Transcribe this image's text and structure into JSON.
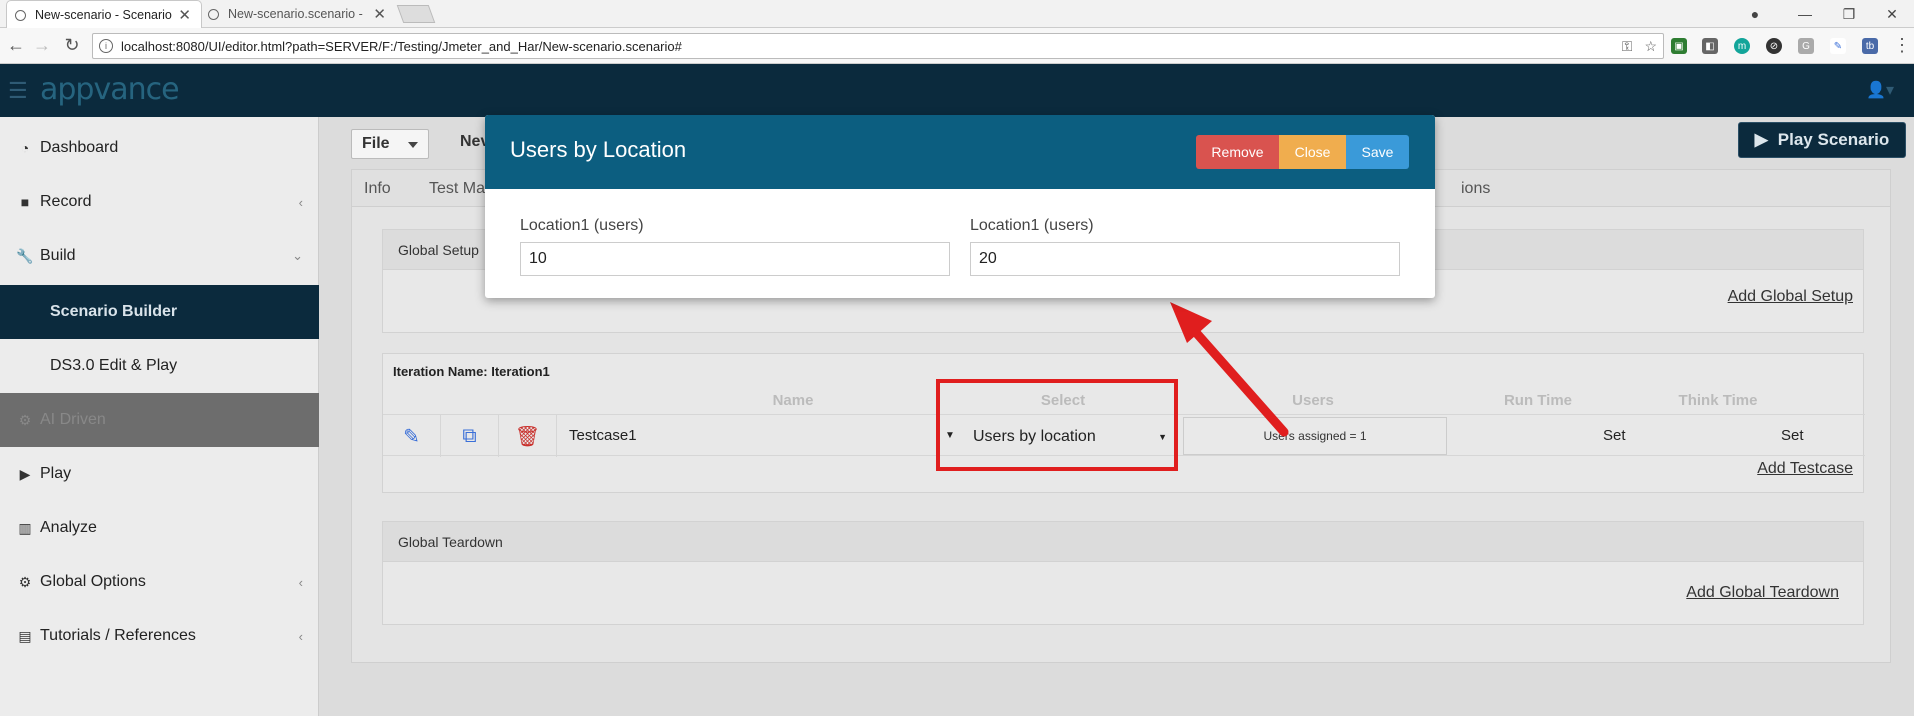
{
  "browser": {
    "tabs": [
      {
        "title": "New-scenario - Scenario"
      },
      {
        "title": "New-scenario.scenario -"
      }
    ],
    "url": "localhost:8080/UI/editor.html?path=SERVER/F:/Testing/Jmeter_and_Har/New-scenario.scenario#"
  },
  "app": {
    "logo": "appvance"
  },
  "sidebar": {
    "items": [
      {
        "label": "Dashboard"
      },
      {
        "label": "Record"
      },
      {
        "label": "Build"
      },
      {
        "label": "Scenario Builder"
      },
      {
        "label": "DS3.0 Edit & Play"
      },
      {
        "label": "AI Driven"
      },
      {
        "label": "Play"
      },
      {
        "label": "Analyze"
      },
      {
        "label": "Global Options"
      },
      {
        "label": "Tutorials / References"
      }
    ]
  },
  "toolbar": {
    "file_label": "File",
    "name_partial": "Nev",
    "play_label": "Play Scenario"
  },
  "tabs": {
    "info": "Info",
    "test_partial": "Test Ma",
    "options_partial": "ions"
  },
  "global_setup": {
    "title": "Global Setup",
    "add_link": "Add Global Setup"
  },
  "iteration": {
    "header": "Iteration Name: Iteration1",
    "columns": [
      "Name",
      "Select",
      "Users",
      "Run Time",
      "Think Time"
    ],
    "row": {
      "name": "Testcase1",
      "select": "Users by location",
      "users": "Users assigned = 1",
      "run_time": "Set",
      "think_time": "Set"
    },
    "add_link": "Add Testcase"
  },
  "global_teardown": {
    "title": "Global Teardown",
    "add_link": "Add Global Teardown"
  },
  "modal": {
    "title": "Users by Location",
    "remove_label": "Remove",
    "close_label": "Close",
    "save_label": "Save",
    "fields": [
      {
        "label": "Location1 (users)",
        "value": "10"
      },
      {
        "label": "Location1 (users)",
        "value": "20"
      }
    ]
  },
  "colors": {
    "header_bg": "#0b2a3d",
    "modal_header": "#0c5e80",
    "remove": "#d9534f",
    "close": "#f0ad4e",
    "save": "#3a9ad9",
    "annotation": "#e01e1e"
  }
}
